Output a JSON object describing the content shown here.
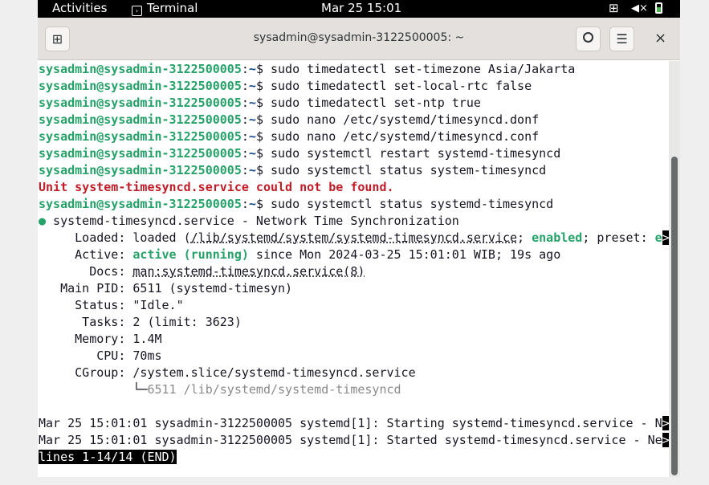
{
  "topbar": {
    "activities": "Activities",
    "app": "Terminal",
    "clock": "Mar 25  15:01",
    "icons": [
      "network-icon",
      "volume-muted-icon",
      "battery-icon"
    ]
  },
  "window": {
    "title": "sysadmin@sysadmin-3122500005: ~",
    "new_tab": "⊞",
    "search": "🔍",
    "menu": "☰",
    "close": "×"
  },
  "terminal": {
    "lines": [
      [
        {
          "c": "pg",
          "t": "sysadmin@sysadmin-3122500005"
        },
        {
          "t": ":"
        },
        {
          "c": "pb",
          "t": "~"
        },
        {
          "t": "$ sudo timedatectl set-timezone Asia/Jakarta"
        }
      ],
      [
        {
          "c": "pg",
          "t": "sysadmin@sysadmin-3122500005"
        },
        {
          "t": ":"
        },
        {
          "c": "pb",
          "t": "~"
        },
        {
          "t": "$ sudo timedatectl set-local-rtc false"
        }
      ],
      [
        {
          "c": "pg",
          "t": "sysadmin@sysadmin-3122500005"
        },
        {
          "t": ":"
        },
        {
          "c": "pb",
          "t": "~"
        },
        {
          "t": "$ sudo timedatectl set-ntp true"
        }
      ],
      [
        {
          "c": "pg",
          "t": "sysadmin@sysadmin-3122500005"
        },
        {
          "t": ":"
        },
        {
          "c": "pb",
          "t": "~"
        },
        {
          "t": "$ sudo nano /etc/systemd/timesyncd.donf"
        }
      ],
      [
        {
          "c": "pg",
          "t": "sysadmin@sysadmin-3122500005"
        },
        {
          "t": ":"
        },
        {
          "c": "pb",
          "t": "~"
        },
        {
          "t": "$ sudo nano /etc/systemd/timesyncd.conf"
        }
      ],
      [
        {
          "c": "pg",
          "t": "sysadmin@sysadmin-3122500005"
        },
        {
          "t": ":"
        },
        {
          "c": "pb",
          "t": "~"
        },
        {
          "t": "$ sudo systemctl restart systemd-timesyncd"
        }
      ],
      [
        {
          "c": "pg",
          "t": "sysadmin@sysadmin-3122500005"
        },
        {
          "t": ":"
        },
        {
          "c": "pb",
          "t": "~"
        },
        {
          "t": "$ sudo systemctl status system-timesyncd"
        }
      ],
      [
        {
          "c": "red",
          "t": "Unit system-timesyncd.service could not be found."
        }
      ],
      [
        {
          "c": "pg",
          "t": "sysadmin@sysadmin-3122500005"
        },
        {
          "t": ":"
        },
        {
          "c": "pb",
          "t": "~"
        },
        {
          "t": "$ sudo systemctl status systemd-timesyncd"
        }
      ],
      [
        {
          "c": "grn",
          "t": "●"
        },
        {
          "t": " systemd-timesyncd.service - Network Time Synchronization"
        }
      ],
      [
        {
          "t": "     Loaded: loaded ("
        },
        {
          "c": "ul",
          "t": "/lib/systemd/system/systemd-timesyncd.service"
        },
        {
          "t": "; "
        },
        {
          "c": "grn",
          "t": "enabled"
        },
        {
          "t": "; preset: "
        },
        {
          "c": "grn",
          "t": "e"
        },
        {
          "c": "inv",
          "t": ">"
        }
      ],
      [
        {
          "t": "     Active: "
        },
        {
          "c": "grn",
          "t": "active (running)"
        },
        {
          "t": " since Mon 2024-03-25 15:01:01 WIB; 19s ago"
        }
      ],
      [
        {
          "t": "       Docs: "
        },
        {
          "c": "ul",
          "t": "man:systemd-timesyncd.service(8)"
        }
      ],
      [
        {
          "t": "   Main PID: 6511 (systemd-timesyn)"
        }
      ],
      [
        {
          "t": "     Status: \"Idle.\""
        }
      ],
      [
        {
          "t": "      Tasks: 2 (limit: 3623)"
        }
      ],
      [
        {
          "t": "     Memory: 1.4M"
        }
      ],
      [
        {
          "t": "        CPU: 70ms"
        }
      ],
      [
        {
          "t": "     CGroup: /system.slice/systemd-timesyncd.service"
        }
      ],
      [
        {
          "t": "             └─"
        },
        {
          "c": "dim",
          "t": "6511 /lib/systemd/systemd-timesyncd"
        }
      ],
      [
        {
          "t": ""
        }
      ],
      [
        {
          "t": "Mar 25 15:01:01 sysadmin-3122500005 systemd[1]: Starting systemd-timesyncd.service - N"
        },
        {
          "c": "inv",
          "t": ">"
        }
      ],
      [
        {
          "t": "Mar 25 15:01:01 sysadmin-3122500005 systemd[1]: Started systemd-timesyncd.service - Ne"
        },
        {
          "c": "inv",
          "t": ">"
        }
      ],
      [
        {
          "c": "inv",
          "t": "lines 1-14/14 (END)"
        }
      ]
    ]
  }
}
